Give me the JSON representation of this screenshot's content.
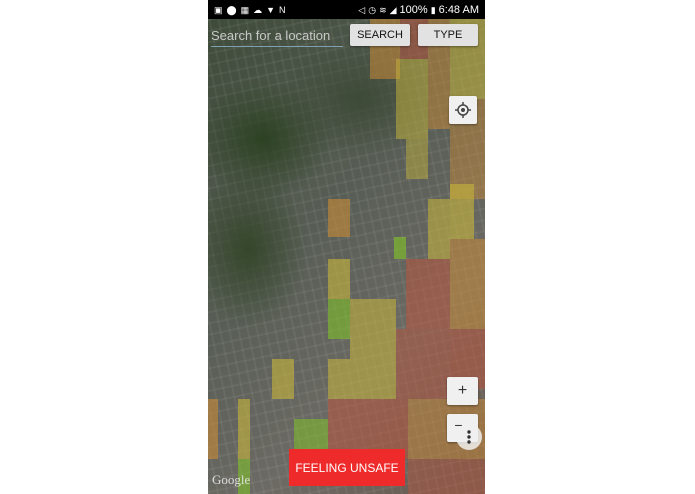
{
  "status_bar": {
    "battery_text": "100%",
    "time": "6:48 AM",
    "left_icons": [
      "message-icon",
      "location-pin-icon",
      "image-icon",
      "cloud-icon",
      "download-icon",
      "nfc-icon"
    ],
    "right_icons": [
      "mute-icon",
      "alarm-icon",
      "wifi-icon",
      "signal-icon",
      "battery-icon"
    ]
  },
  "search": {
    "placeholder": "Search for a location",
    "value": "",
    "search_label": "SEARCH",
    "type_label": "TYPE"
  },
  "controls": {
    "zoom_in_label": "+",
    "zoom_out_label": "−",
    "feeling_unsafe_label": "FEELING UNSAFE"
  },
  "map": {
    "attribution": "Google",
    "overlay_colors": {
      "green": "#7fbf2a",
      "yellow": "#c8b63a",
      "orange": "#c98a36",
      "red": "#b8563e"
    }
  }
}
